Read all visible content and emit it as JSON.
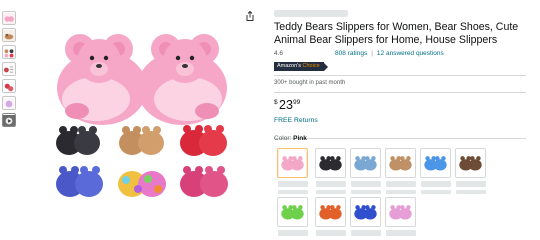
{
  "product": {
    "title": "Teddy Bears Slippers for Women, Bear Shoes, Cute Animal Bear Slippers for Home, House Slippers",
    "rating": "4.6",
    "ratings_count": "808 ratings",
    "answered_questions": "12 answered questions",
    "badge": {
      "brand": "Amazon's",
      "label": "Choice"
    },
    "bought_text": "300+ bought in past month",
    "price": {
      "currency": "$",
      "whole": "23",
      "fraction": "99"
    },
    "returns": "FREE Returns"
  },
  "color": {
    "label": "Color:",
    "selected": "Pink",
    "swatches": [
      {
        "icon": "bear-slipper-icon",
        "color": "#f4a8c8"
      },
      {
        "icon": "bear-slipper-icon",
        "color": "#2b2b30"
      },
      {
        "icon": "bear-slipper-icon",
        "color": "#7ba7d4"
      },
      {
        "icon": "bear-slipper-icon",
        "color": "#c09066"
      },
      {
        "icon": "bear-slipper-icon",
        "color": "#4c96e8"
      },
      {
        "icon": "bear-slipper-icon",
        "color": "#6e4b35"
      },
      {
        "icon": "bear-slipper-icon",
        "color": "#6fd04c"
      },
      {
        "icon": "bear-slipper-icon",
        "color": "#e2602a"
      },
      {
        "icon": "bear-slipper-icon",
        "color": "#2f4fcf"
      },
      {
        "icon": "bear-slipper-icon",
        "color": "#e59fd6"
      }
    ]
  },
  "icons": {
    "share": "share-icon",
    "play": "play-icon"
  }
}
